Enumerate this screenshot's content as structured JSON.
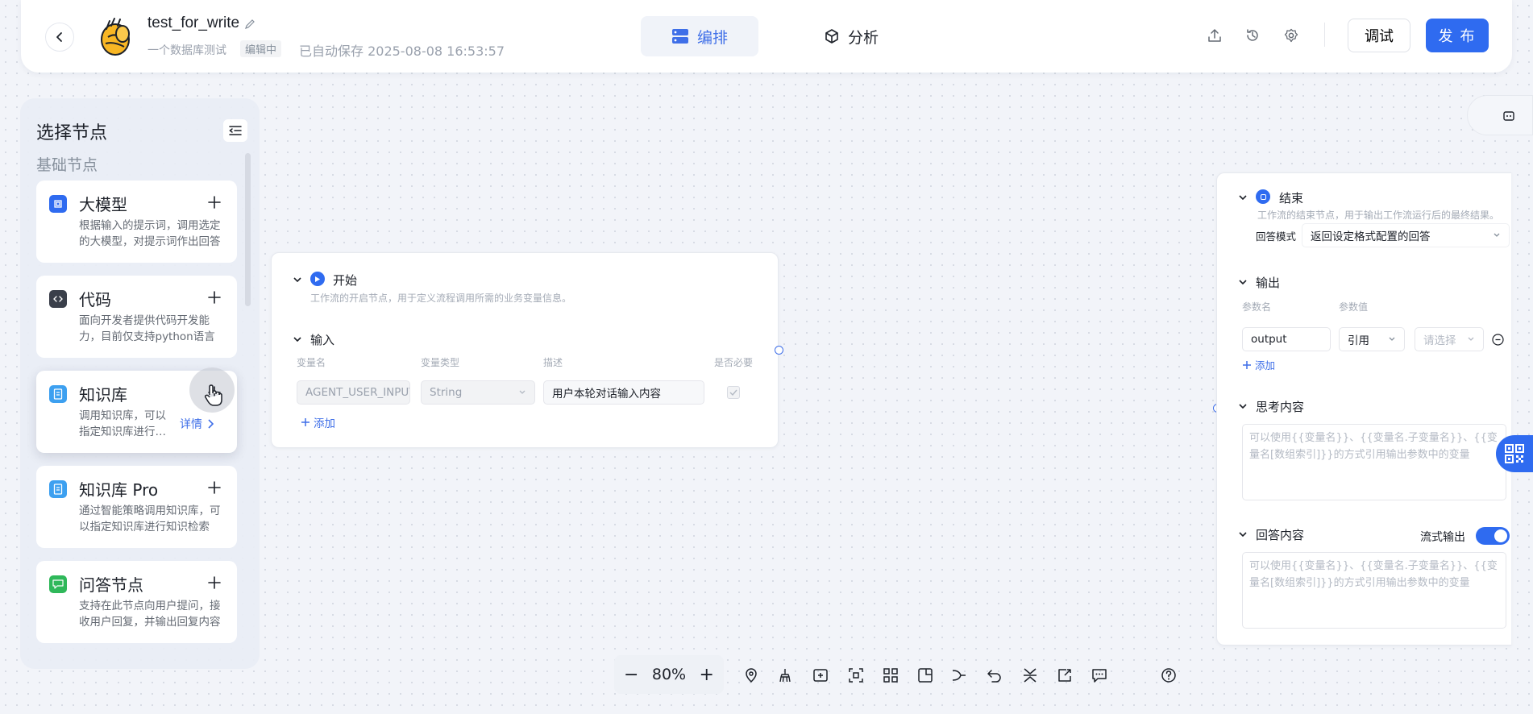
{
  "header": {
    "app_name": "test_for_write",
    "app_desc": "一个数据库测试",
    "status": "编辑中",
    "autosave": "已自动保存 2025-08-08 16:53:57",
    "tabs": [
      {
        "label": "编排",
        "icon": "server-stack-icon",
        "active": true
      },
      {
        "label": "分析",
        "icon": "cube-icon",
        "active": false
      }
    ],
    "debug_label": "调试",
    "publish_label": "发 布",
    "accent": "#2f6bf0"
  },
  "node_panel": {
    "title": "选择节点",
    "section": "基础节点",
    "nodes": [
      {
        "title": "大模型",
        "desc": "根据输入的提示词，调用选定的大模型，对提示词作出回答",
        "icon_color": "#2f6bf0"
      },
      {
        "title": "代码",
        "desc": "面向开发者提供代码开发能力，目前仅支持python语言",
        "icon_color": "#3a3f4a"
      },
      {
        "title": "知识库",
        "desc": "调用知识库，可以指定知识库进行知识检索",
        "icon_color": "#3da0f0",
        "detail": "详情"
      },
      {
        "title": "知识库 Pro",
        "desc": "通过智能策略调用知识库，可以指定知识库进行知识检索",
        "icon_color": "#3da0f0"
      },
      {
        "title": "问答节点",
        "desc": "支持在此节点向用户提问，接收用户回复，并输出回复内容",
        "icon_color": "#2fb85a"
      }
    ]
  },
  "start_node": {
    "title": "开始",
    "desc": "工作流的开启节点，用于定义流程调用所需的业务变量信息。",
    "input_section": "输入",
    "columns": [
      "变量名",
      "变量类型",
      "描述",
      "是否必要"
    ],
    "row": {
      "name": "AGENT_USER_INPUT",
      "type": "String",
      "desc": "用户本轮对话输入内容"
    },
    "add_label": "添加"
  },
  "end_node": {
    "title": "结束",
    "desc": "工作流的结束节点，用于输出工作流运行后的最终结果。",
    "answer_mode_label": "回答模式",
    "answer_mode_value": "返回设定格式配置的回答",
    "output_section": "输出",
    "param_name_col": "参数名",
    "param_value_col": "参数值",
    "output_name": "output",
    "ref_label": "引用",
    "select_placeholder": "请选择",
    "add_label": "添加",
    "thinking_section": "思考内容",
    "thinking_placeholder": "可以使用{{变量名}}、{{变量名.子变量名}}、{{变量名[数组索引]}}的方式引用输出参数中的变量",
    "answer_section": "回答内容",
    "stream_label": "流式输出",
    "stream_on": true,
    "answer_placeholder": "可以使用{{变量名}}、{{变量名.子变量名}}、{{变量名[数组索引]}}的方式引用输出参数中的变量"
  },
  "toolbar": {
    "zoom": "80%"
  }
}
